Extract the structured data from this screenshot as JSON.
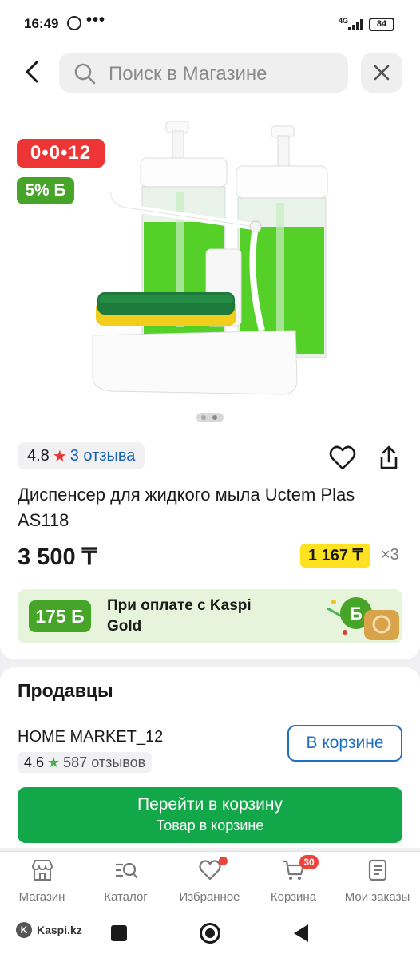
{
  "status_bar": {
    "time": "16:49",
    "dots": "•••",
    "network": "4G",
    "battery": "84"
  },
  "header": {
    "search_placeholder": "Поиск в Магазине",
    "back_icon": "chevron-left-icon",
    "close_icon": "close-icon"
  },
  "gallery": {
    "timer": "0•0•12",
    "bonus": "5% Б",
    "slides_total": 2,
    "slide_active": 2
  },
  "product": {
    "rating": "4.8",
    "reviews": "3 отзыва",
    "title": "Диспенсер для жидкого мыла Uctem Plas AS118",
    "price": "3 500 ₸",
    "installment": "1 167 ₸",
    "installment_multiplier": "×3"
  },
  "kaspi_gold": {
    "bonus": "175 Б",
    "text": "При оплате с Kaspi Gold"
  },
  "sellers": {
    "title": "Продавцы",
    "seller_name": "HOME MARKET_12",
    "seller_rating": "4.6",
    "seller_reviews": "587 отзывов",
    "in_cart_label": "В корзине",
    "go_to_cart_label": "Перейти в корзину",
    "go_to_cart_sub": "Товар в корзине"
  },
  "bottom_nav": {
    "items": [
      {
        "label": "Магазин",
        "icon": "shop-icon"
      },
      {
        "label": "Каталог",
        "icon": "catalog-search-icon"
      },
      {
        "label": "Избранное",
        "icon": "heart-icon"
      },
      {
        "label": "Корзина",
        "icon": "cart-icon"
      },
      {
        "label": "Мои заказы",
        "icon": "orders-icon"
      }
    ],
    "cart_count": "30"
  },
  "system_bar": {
    "brand": "Kaspi.kz"
  },
  "colors": {
    "timer_red": "#ee3535",
    "bonus_green": "#46a428",
    "cta_green": "#12a84a",
    "link_blue": "#1560b8",
    "installment_yellow": "#ffe21f"
  }
}
